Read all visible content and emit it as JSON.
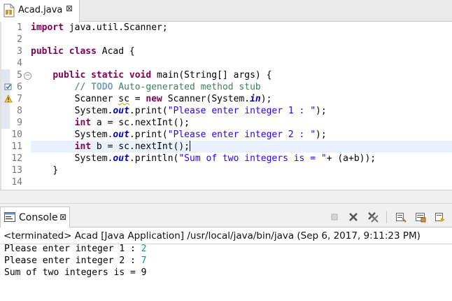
{
  "editor_tab": {
    "title": "Acad.java",
    "close_glyph": "⊠"
  },
  "code": {
    "line_numbers": [
      "1",
      "2",
      "3",
      "4",
      "5",
      "6",
      "7",
      "8",
      "9",
      "10",
      "11",
      "12",
      "13",
      "14"
    ],
    "l1": {
      "kw": "import",
      "rest": " java.util.Scanner;"
    },
    "l3": {
      "kw1": "public",
      "kw2": "class",
      "rest": " Acad {"
    },
    "l5": {
      "indent": "    ",
      "kw1": "public",
      "kw2": "static",
      "kw3": "void",
      "rest": " main(String[] args) {"
    },
    "l6": {
      "indent": "        ",
      "comment_start": "// ",
      "todo": "TODO",
      "comment_rest": " Auto-generated method stub"
    },
    "l7": {
      "indent": "        ",
      "pre": "Scanner ",
      "var": "sc",
      "eq": " = ",
      "kw": "new",
      "mid": " Scanner(System.",
      "fld": "in",
      "post": ");"
    },
    "l8": {
      "indent": "        ",
      "pre": "System.",
      "fld": "out",
      "mid": ".print(",
      "str": "\"Please enter integer 1 : \"",
      "post": ");"
    },
    "l9": {
      "indent": "        ",
      "kw": "int",
      "rest": " a = sc.nextInt();"
    },
    "l10": {
      "indent": "        ",
      "pre": "System.",
      "fld": "out",
      "mid": ".print(",
      "str": "\"Please enter integer 2 : \"",
      "post": ");"
    },
    "l11": {
      "indent": "        ",
      "kw": "int",
      "rest": " b = sc.nextInt();"
    },
    "l12": {
      "indent": "        ",
      "pre": "System.",
      "fld": "out",
      "mid": ".println(",
      "str": "\"Sum of two integers is = \"",
      "post": "+ (a+b));"
    },
    "l13": {
      "text": "    }"
    }
  },
  "console": {
    "tab_title": "Console",
    "close_glyph": "⊠",
    "status": "<terminated> Acad [Java Application] /usr/local/java/bin/java (Sep 6, 2017, 9:11:23 PM)",
    "output": [
      {
        "prompt": "Please enter integer 1 : ",
        "input": "2"
      },
      {
        "prompt": "Please enter integer 2 : ",
        "input": "7"
      },
      {
        "prompt": "Sum of two integers is = 9",
        "input": ""
      }
    ]
  },
  "colors": {
    "keyword": "#7f0055",
    "string": "#2a00ff",
    "field": "#0000c0",
    "comment": "#3f7f5f",
    "todo": "#7f9fbf",
    "stdin": "#00a080",
    "current_line": "#e8f2fe"
  }
}
